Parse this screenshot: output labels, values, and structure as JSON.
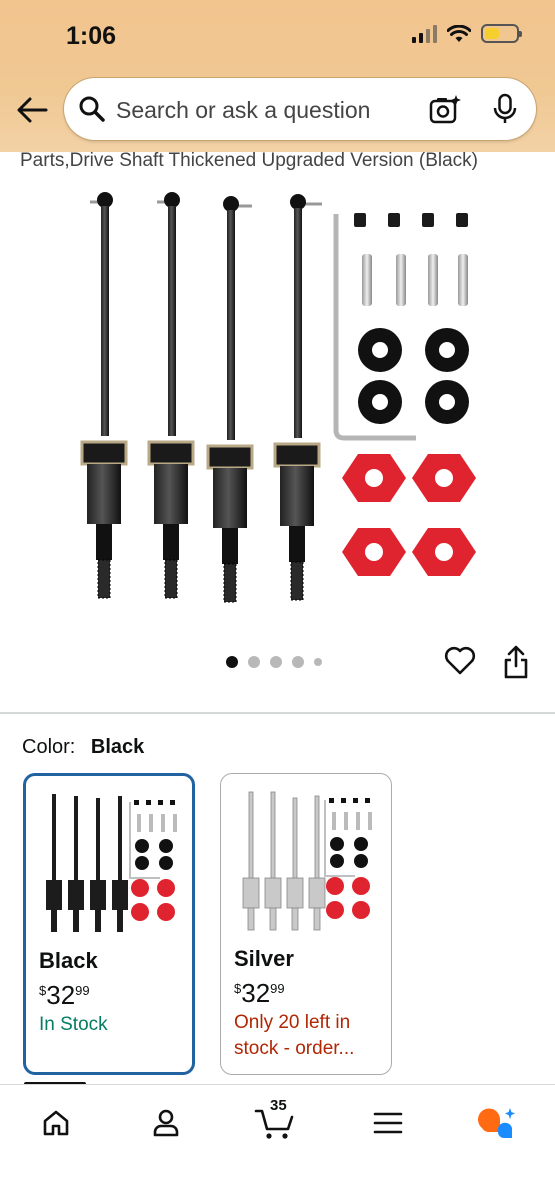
{
  "status_bar": {
    "time": "1:06"
  },
  "search": {
    "placeholder": "Search or ask a question"
  },
  "product": {
    "title": "Parts,Drive Shaft Thickened Upgraded Version (Black)",
    "image_count": 5,
    "active_image": 1
  },
  "variation": {
    "label": "Color:",
    "selected": "Black",
    "options": [
      {
        "name": "Black",
        "price_dollars": "32",
        "price_cents": "99",
        "currency": "$",
        "stock": "In Stock"
      },
      {
        "name": "Silver",
        "price_dollars": "32",
        "price_cents": "99",
        "currency": "$",
        "stock": "Only 20 left in stock - order..."
      }
    ]
  },
  "bottom_nav": {
    "items": [
      "home-icon",
      "account-icon",
      "cart-icon",
      "menu-icon",
      "rufus-icon"
    ],
    "cart_count": "35"
  },
  "colors": {
    "header_bg": "#f2c48e",
    "selected_border": "#2162a1",
    "in_stock": "#067d62",
    "low_stock": "#b12704",
    "part_red": "#e0242f",
    "rufus_orange": "#ff6a13",
    "rufus_blue": "#1a8cff"
  }
}
